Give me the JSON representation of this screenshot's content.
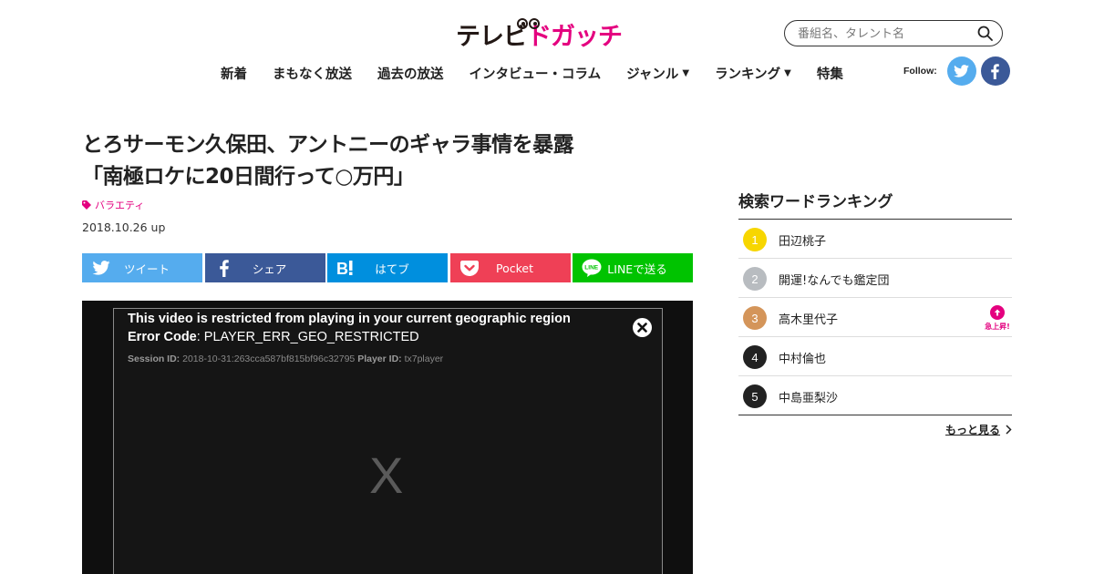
{
  "header": {
    "logo": {
      "part1": "テレビ",
      "part2": "ドガッチ"
    },
    "search": {
      "placeholder": "番組名、タレント名"
    },
    "nav": [
      {
        "label": "新着",
        "has_dropdown": false
      },
      {
        "label": "まもなく放送",
        "has_dropdown": false
      },
      {
        "label": "過去の放送",
        "has_dropdown": false
      },
      {
        "label": "インタビュー・コラム",
        "has_dropdown": false
      },
      {
        "label": "ジャンル",
        "has_dropdown": true
      },
      {
        "label": "ランキング",
        "has_dropdown": true
      },
      {
        "label": "特集",
        "has_dropdown": false
      }
    ],
    "follow_label": "Follow:",
    "social": [
      "twitter-icon",
      "facebook-icon"
    ]
  },
  "article": {
    "title_line1": "とろサーモン久保田、アントニーのギャラ事情を暴露",
    "title_line2": "「南極ロケに20日間行って○万円」",
    "category": "バラエティ",
    "date": "2018.10.26 up"
  },
  "share_buttons": [
    {
      "label": "ツイート",
      "icon": "twitter-icon",
      "color": "#55acee"
    },
    {
      "label": "シェア",
      "icon": "facebook-icon",
      "color": "#3b5998"
    },
    {
      "label": "はてブ",
      "icon": "hatena-icon",
      "color": "#008fde"
    },
    {
      "label": "Pocket",
      "icon": "pocket-icon",
      "color": "#ef4056"
    },
    {
      "label": "LINEで送る",
      "icon": "line-icon",
      "color": "#00c300"
    }
  ],
  "player": {
    "error_message": "This video is restricted from playing in your current geographic region",
    "error_code_label": "Error Code",
    "error_code_value": ": PLAYER_ERR_GEO_RESTRICTED",
    "session_label": "Session ID:",
    "session_value": "2018-10-31:263cca587bf815bf96c32795",
    "player_label": "Player ID:",
    "player_value": "tx7player",
    "placeholder_glyph": "X"
  },
  "ranking": {
    "title": "検索ワードランキング",
    "items": [
      {
        "rank": "1",
        "name": "田辺桃子",
        "color": "#f7d600",
        "badge": ""
      },
      {
        "rank": "2",
        "name": "開運!なんでも鑑定団",
        "color": "#b8bcc0",
        "badge": ""
      },
      {
        "rank": "3",
        "name": "高木里代子",
        "color": "#d4955a",
        "badge": "急上昇!"
      },
      {
        "rank": "4",
        "name": "中村倫也",
        "color": "#222222",
        "badge": ""
      },
      {
        "rank": "5",
        "name": "中島亜梨沙",
        "color": "#222222",
        "badge": ""
      }
    ],
    "more_label": "もっと見る"
  }
}
